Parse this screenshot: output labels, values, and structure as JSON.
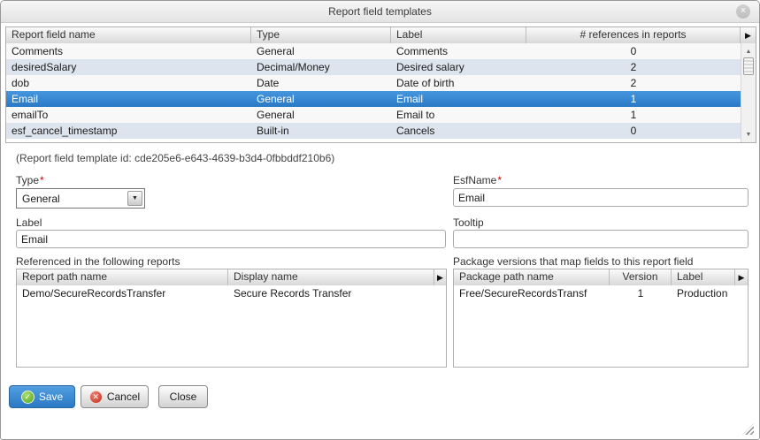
{
  "dialog": {
    "title": "Report field templates"
  },
  "icons": {
    "close": "×",
    "check": "✓",
    "cancel_x": "✕",
    "column_menu": "▶",
    "scroll_up": "▲",
    "scroll_down": "▼",
    "dropdown": "▼"
  },
  "fields_table": {
    "columns": [
      "Report field name",
      "Type",
      "Label",
      "# references in reports"
    ],
    "rows": [
      {
        "name": "Comments",
        "type": "General",
        "label": "Comments",
        "refs": "0"
      },
      {
        "name": "desiredSalary",
        "type": "Decimal/Money",
        "label": "Desired salary",
        "refs": "2"
      },
      {
        "name": "dob",
        "type": "Date",
        "label": "Date of birth",
        "refs": "2"
      },
      {
        "name": "Email",
        "type": "General",
        "label": "Email",
        "refs": "1"
      },
      {
        "name": "emailTo",
        "type": "General",
        "label": "Email to",
        "refs": "1"
      },
      {
        "name": "esf_cancel_timestamp",
        "type": "Built-in",
        "label": "Cancels",
        "refs": "0"
      }
    ],
    "selected_row_index": 3
  },
  "form": {
    "template_id_note": "(Report field template id: cde205e6-e643-4639-b3d4-0fbbddf210b6)",
    "type": {
      "label": "Type",
      "required_mark": "*",
      "value": "General"
    },
    "esf_name": {
      "label": "EsfName",
      "required_mark": "*",
      "value": "Email"
    },
    "label_field": {
      "label": "Label",
      "value": "Email"
    },
    "tooltip_field": {
      "label": "Tooltip",
      "value": ""
    }
  },
  "referenced_reports": {
    "heading": "Referenced in the following reports",
    "columns": [
      "Report path name",
      "Display name"
    ],
    "rows": [
      {
        "path": "Demo/SecureRecordsTransfer",
        "display": "Secure Records Transfer"
      }
    ]
  },
  "package_versions": {
    "heading": "Package versions that map fields to this report field",
    "columns": [
      "Package path name",
      "Version",
      "Label"
    ],
    "rows": [
      {
        "path": "Free/SecureRecordsTransf",
        "version": "1",
        "label": "Production"
      }
    ]
  },
  "buttons": {
    "save": "Save",
    "cancel": "Cancel",
    "close": "Close"
  },
  "colors": {
    "selected_row_top": "#4696de",
    "selected_row_bottom": "#2a79c6",
    "alt_row": "#dde4ee",
    "row": "#f8f8f9",
    "save_button": "#2b79c4",
    "required_mark": "#cc0000",
    "save_icon_green": "#56a320",
    "cancel_icon_red": "#c02f1d"
  }
}
